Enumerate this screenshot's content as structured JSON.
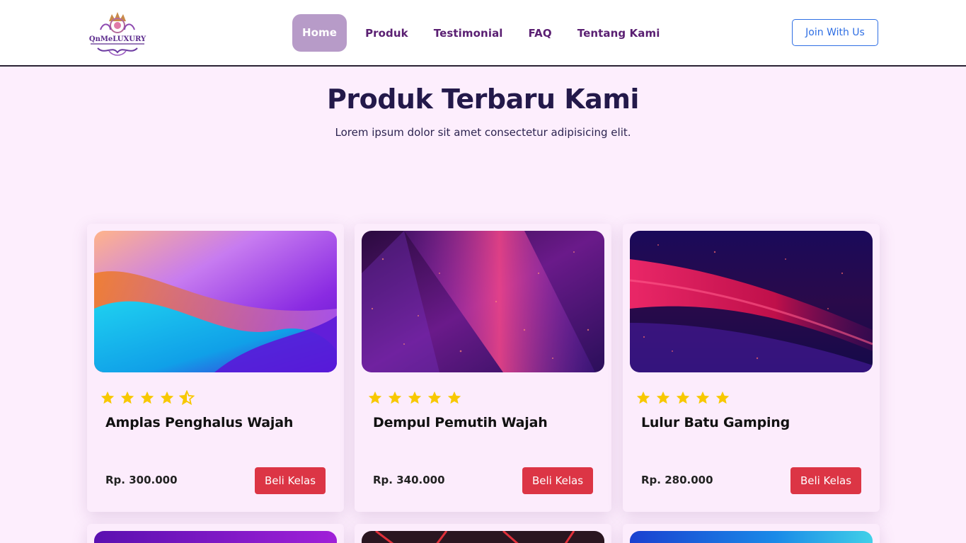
{
  "nav": {
    "logo_alt": "QnMeLUXURY",
    "links": [
      {
        "label": "Home",
        "active": true
      },
      {
        "label": "Produk",
        "active": false
      },
      {
        "label": "Testimonial",
        "active": false
      },
      {
        "label": "FAQ",
        "active": false
      },
      {
        "label": "Tentang Kami",
        "active": false
      }
    ],
    "cta_label": "Join With Us"
  },
  "section": {
    "title": "Produk Terbaru Kami",
    "subtitle": "Lorem ipsum dolor sit amet consectetur adipisicing elit."
  },
  "products": [
    {
      "title": "Amplas Penghalus Wajah",
      "price": "Rp. 300.000",
      "button": "Beli Kelas",
      "rating": 4.5
    },
    {
      "title": "Dempul Pemutih Wajah",
      "price": "Rp. 340.000",
      "button": "Beli Kelas",
      "rating": 5
    },
    {
      "title": "Lulur Batu Gamping",
      "price": "Rp. 280.000",
      "button": "Beli Kelas",
      "rating": 5
    }
  ],
  "colors": {
    "background": "#fdeefd",
    "nav_text": "#5a1f72",
    "nav_active_bg": "#b79bc8",
    "cta_border": "#2f6fe4",
    "buy_button": "#dc3545",
    "star": "#f7c800"
  },
  "icons": {
    "star_full": "star-icon",
    "star_half": "star-half-icon"
  }
}
